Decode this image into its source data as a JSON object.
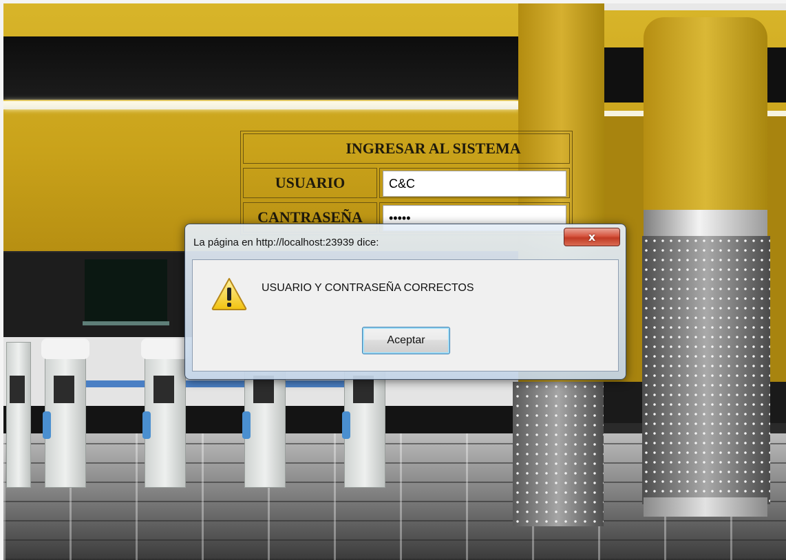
{
  "form": {
    "title": "INGRESAR AL SISTEMA",
    "username_label": "USUARIO",
    "username_value": "C&C",
    "password_label": "CANTRASEÑA",
    "password_value": "•••••"
  },
  "dialog": {
    "caption": "La página en http://localhost:23939 dice:",
    "close_glyph": "x",
    "message": "USUARIO Y CONTRASEÑA CORRECTOS",
    "ok_label": "Aceptar",
    "icon": "warning-icon"
  }
}
